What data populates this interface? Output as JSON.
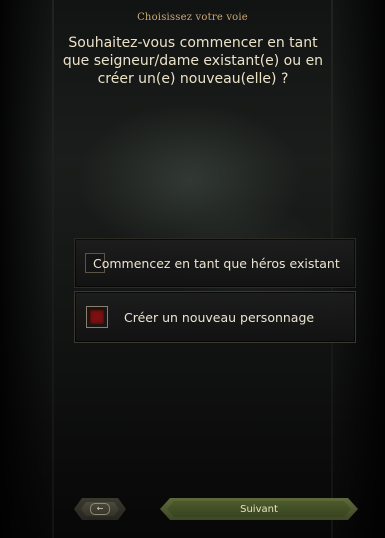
{
  "header": {
    "subtitle": "Choisissez votre voie",
    "question": "Souhaitez-vous commencer en tant que seigneur/dame existant(e) ou en créer un(e) nouveau(elle) ?"
  },
  "options": [
    {
      "label": "Commencez en tant que héros existant",
      "selected": false
    },
    {
      "label": "Créer un nouveau personnage",
      "selected": true
    }
  ],
  "footer": {
    "back_icon": "←",
    "next_label": "Suivant"
  },
  "colors": {
    "subtitle": "#cba874",
    "text": "#ece2c8",
    "selected_fill": "#7a1010",
    "next_button": "#4c5a2b"
  }
}
